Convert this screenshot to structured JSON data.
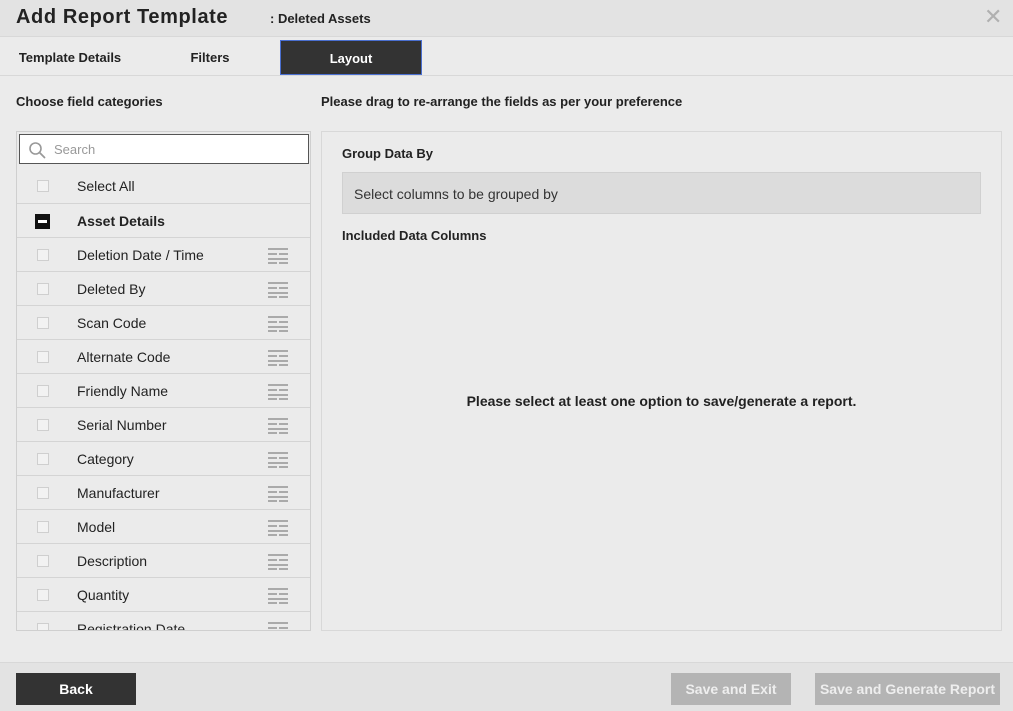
{
  "header": {
    "title": "Add Report Template",
    "subtitle": ": Deleted Assets",
    "close_glyph": "✕"
  },
  "tabs": [
    {
      "label": "Template Details",
      "active": false
    },
    {
      "label": "Filters",
      "active": false
    },
    {
      "label": "Layout",
      "active": true
    }
  ],
  "left": {
    "heading": "Choose field categories",
    "search_placeholder": "Search",
    "select_all_label": "Select All",
    "category_label": "Asset Details",
    "fields": [
      "Deletion Date / Time",
      "Deleted By",
      "Scan Code",
      "Alternate Code",
      "Friendly Name",
      "Serial Number",
      "Category",
      "Manufacturer",
      "Model",
      "Description",
      "Quantity",
      "Registration Date"
    ]
  },
  "right": {
    "heading": "Please drag to re-arrange the fields as per your preference",
    "group_label": "Group Data By",
    "group_placeholder": "Select columns to be grouped by",
    "included_label": "Included Data Columns",
    "empty_message": "Please select at least one option to save/generate a report."
  },
  "footer": {
    "back_label": "Back",
    "save_exit_label": "Save and Exit",
    "save_generate_label": "Save and Generate Report"
  },
  "colors": {
    "active_tab_bg": "#333333",
    "active_tab_border": "#4a6fd0",
    "disabled_button": "#b4b4b4",
    "primary_button": "#333333"
  }
}
